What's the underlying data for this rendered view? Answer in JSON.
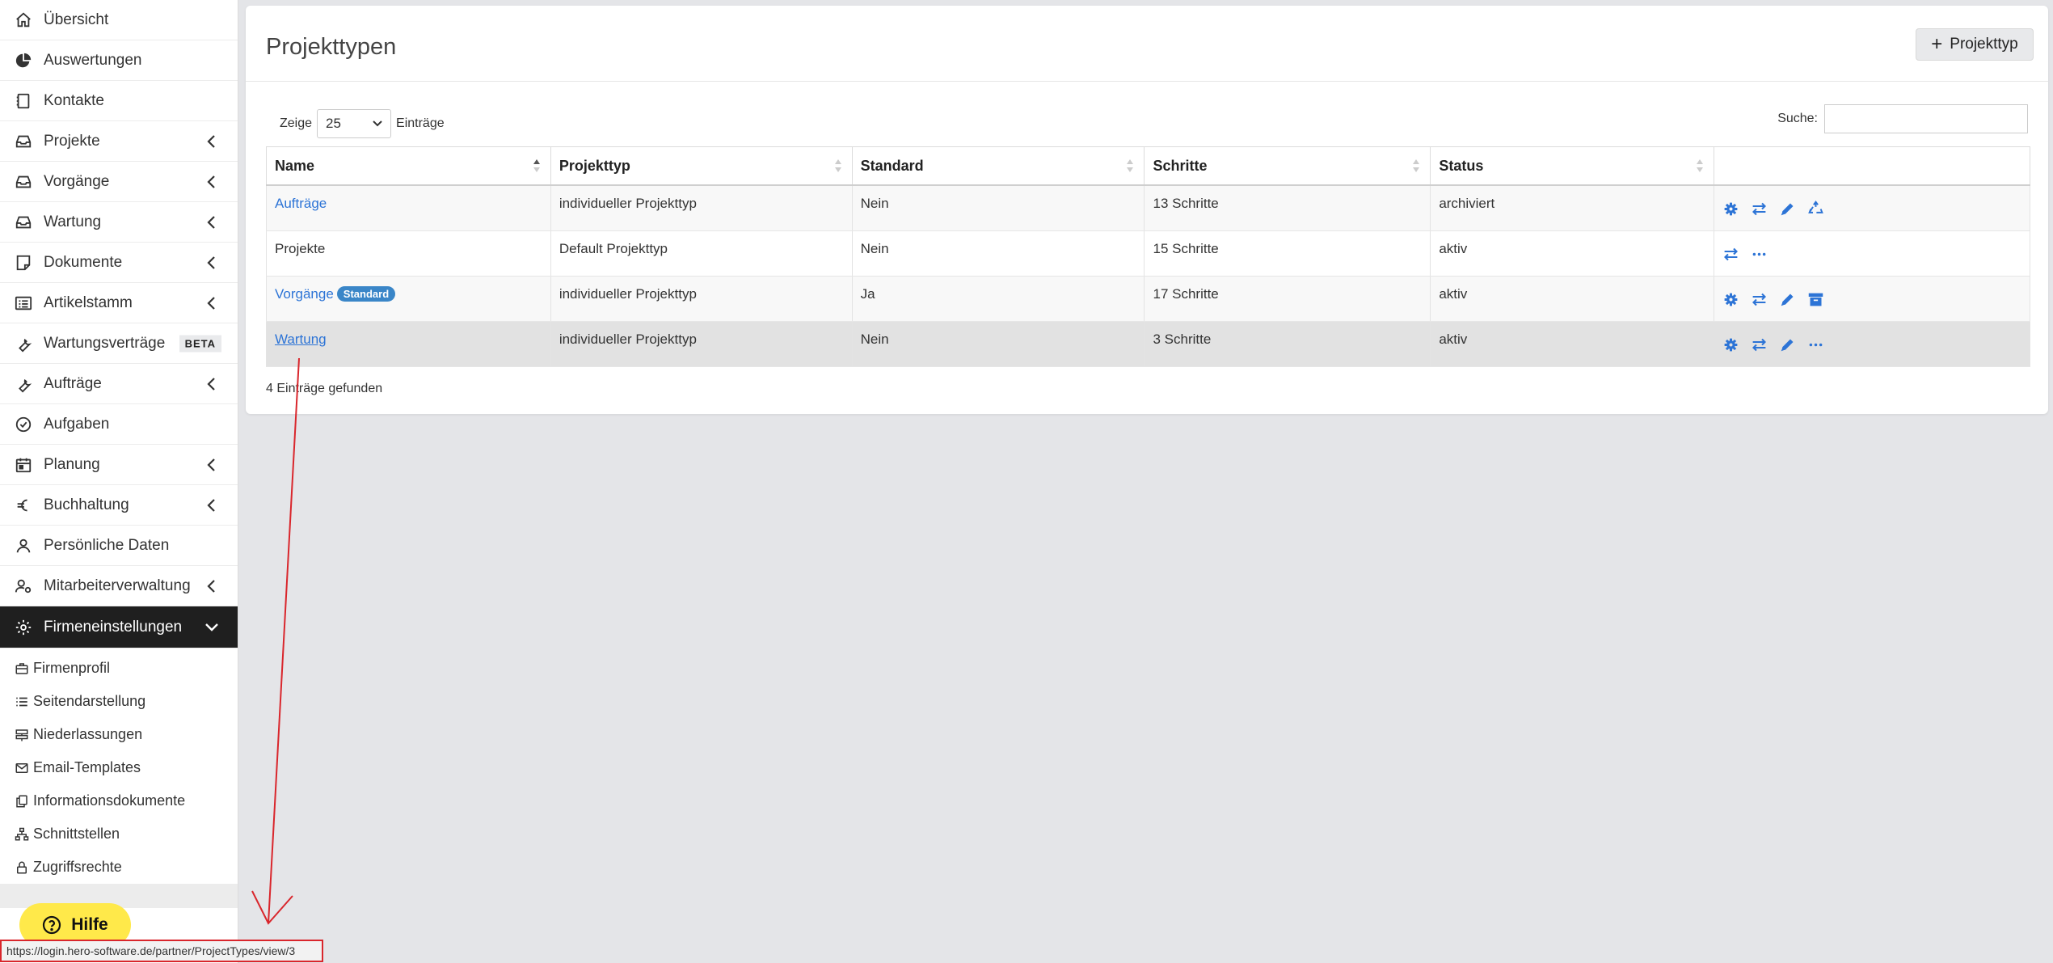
{
  "sidebar": {
    "items": [
      {
        "label": "Übersicht",
        "icon": "home-icon"
      },
      {
        "label": "Auswertungen",
        "icon": "pie-chart-icon"
      },
      {
        "label": "Kontakte",
        "icon": "address-book-icon"
      },
      {
        "label": "Projekte",
        "icon": "inbox-icon"
      },
      {
        "label": "Vorgänge",
        "icon": "inbox-icon"
      },
      {
        "label": "Wartung",
        "icon": "inbox-icon"
      },
      {
        "label": "Dokumente",
        "icon": "note-icon"
      },
      {
        "label": "Artikelstamm",
        "icon": "list-icon"
      },
      {
        "label": "Wartungsverträge",
        "icon": "wrench-icon",
        "badge": "BETA"
      },
      {
        "label": "Aufträge",
        "icon": "wrench-icon"
      },
      {
        "label": "Aufgaben",
        "icon": "check-circle-icon"
      },
      {
        "label": "Planung",
        "icon": "calendar-icon"
      },
      {
        "label": "Buchhaltung",
        "icon": "euro-icon"
      },
      {
        "label": "Persönliche Daten",
        "icon": "user-icon"
      },
      {
        "label": "Mitarbeiterverwaltung",
        "icon": "users-gear-icon"
      },
      {
        "label": "Firmeneinstellungen",
        "icon": "gear-icon"
      }
    ],
    "sub_items": [
      {
        "label": "Firmenprofil",
        "icon": "briefcase-icon"
      },
      {
        "label": "Seitendarstellung",
        "icon": "list-icon"
      },
      {
        "label": "Niederlassungen",
        "icon": "signpost-icon"
      },
      {
        "label": "Email-Templates",
        "icon": "envelope-icon"
      },
      {
        "label": "Informationsdokumente",
        "icon": "copy-icon"
      },
      {
        "label": "Schnittstellen",
        "icon": "sitemap-icon"
      },
      {
        "label": "Zugriffsrechte",
        "icon": "lock-icon"
      }
    ]
  },
  "help": {
    "label": "Hilfe"
  },
  "statusbar": {
    "url": "https://login.hero-software.de/partner/ProjectTypes/view/3"
  },
  "main": {
    "title": "Projekttypen",
    "add_button": "Projekttyp",
    "show_prefix": "Zeige",
    "page_length": "25",
    "show_suffix": "Einträge",
    "search_label": "Suche:",
    "info": "4 Einträge gefunden",
    "columns": [
      "Name",
      "Projekttyp",
      "Standard",
      "Schritte",
      "Status"
    ],
    "rows": [
      {
        "name": "Aufträge",
        "type": "individueller Projekttyp",
        "standard": "Nein",
        "steps": "13 Schritte",
        "status": "archiviert"
      },
      {
        "name": "Projekte",
        "type": "Default Projekttyp",
        "standard": "Nein",
        "steps": "15 Schritte",
        "status": "aktiv"
      },
      {
        "name": "Vorgänge",
        "badge": "Standard",
        "type": "individueller Projekttyp",
        "standard": "Ja",
        "steps": "17 Schritte",
        "status": "aktiv"
      },
      {
        "name": "Wartung",
        "type": "individueller Projekttyp",
        "standard": "Nein",
        "steps": "3 Schritte",
        "status": "aktiv"
      }
    ]
  },
  "colors": {
    "accent": "#2d74d6",
    "active_nav": "#1f1f1f",
    "help": "#ffe94a",
    "annotation": "#d9262c"
  }
}
